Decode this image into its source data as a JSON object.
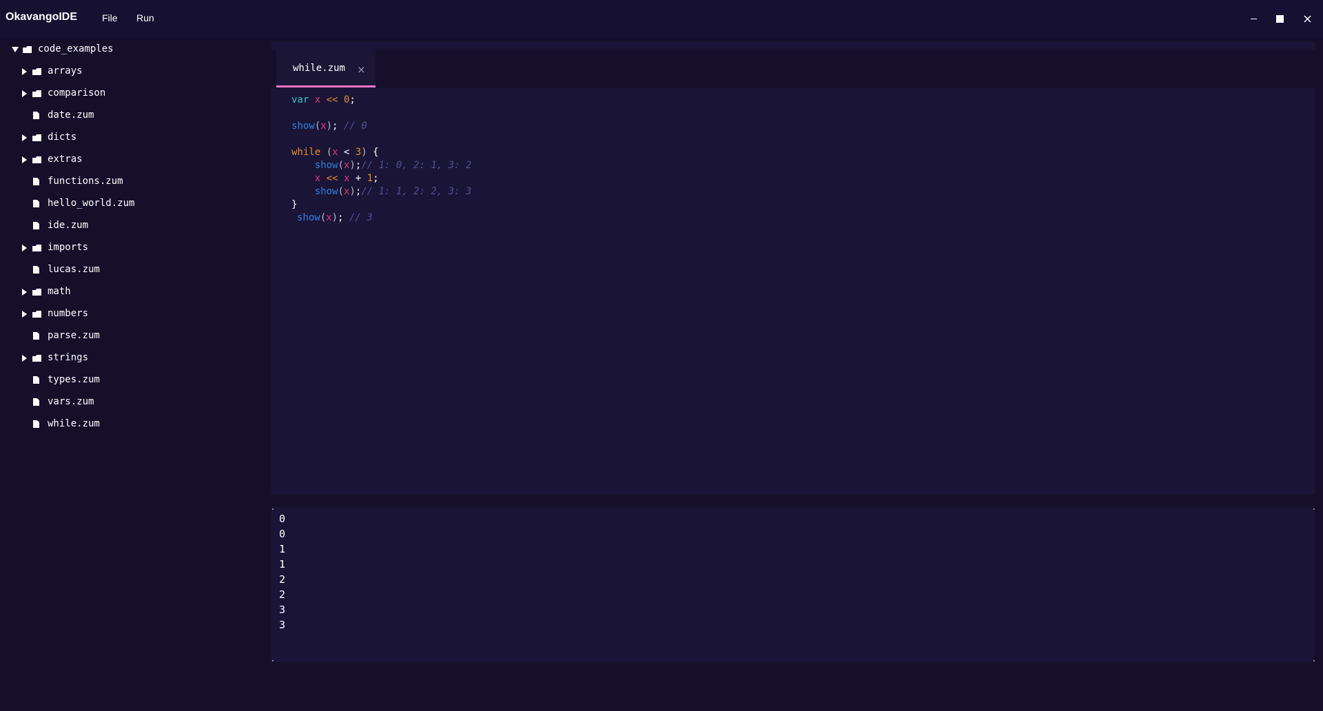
{
  "app": {
    "title": "OkavangoIDE"
  },
  "menu": {
    "file": "File",
    "run": "Run"
  },
  "window_controls": {
    "minimize": "minimize-icon",
    "maximize": "maximize-icon",
    "close": "close-icon"
  },
  "explorer": {
    "root": "code_examples",
    "items": [
      {
        "type": "folder",
        "label": "arrays"
      },
      {
        "type": "folder",
        "label": "comparison"
      },
      {
        "type": "file",
        "label": "date.zum"
      },
      {
        "type": "folder",
        "label": "dicts"
      },
      {
        "type": "folder",
        "label": "extras"
      },
      {
        "type": "file",
        "label": "functions.zum"
      },
      {
        "type": "file",
        "label": "hello_world.zum"
      },
      {
        "type": "file",
        "label": "ide.zum"
      },
      {
        "type": "folder",
        "label": "imports"
      },
      {
        "type": "file",
        "label": "lucas.zum"
      },
      {
        "type": "folder",
        "label": "math"
      },
      {
        "type": "folder",
        "label": "numbers"
      },
      {
        "type": "file",
        "label": "parse.zum"
      },
      {
        "type": "folder",
        "label": "strings"
      },
      {
        "type": "file",
        "label": "types.zum"
      },
      {
        "type": "file",
        "label": "vars.zum"
      },
      {
        "type": "file",
        "label": "while.zum"
      }
    ]
  },
  "editor": {
    "tab": {
      "label": "while.zum",
      "close": "×"
    },
    "code": {
      "l1": {
        "kw": "var",
        "x": "x",
        "op": "<<",
        "num": "0",
        "semi": ";"
      },
      "l2": {
        "fn": "show",
        "lp": "(",
        "x": "x",
        "rp": ")",
        "semi": ";",
        "cmt": "// 0"
      },
      "l3": {
        "kw": "while",
        "lp": "(",
        "x": "x",
        "op": "<",
        "num": "3",
        "rp": ")",
        "brace": "{"
      },
      "l4": {
        "fn": "show",
        "lp": "(",
        "x": "x",
        "rp": ")",
        "semi": ";",
        "cmt": "// 1: 0, 2: 1, 3: 2"
      },
      "l5": {
        "x1": "x",
        "op1": "<<",
        "x2": "x",
        "op2": "+",
        "num": "1",
        "semi": ";"
      },
      "l6": {
        "fn": "show",
        "lp": "(",
        "x": "x",
        "rp": ")",
        "semi": ";",
        "cmt": "// 1: 1, 2: 2, 3: 3"
      },
      "l7": {
        "brace": "}"
      },
      "l8": {
        "fn": "show",
        "lp": "(",
        "x": "x",
        "rp": ")",
        "semi": ";",
        "cmt": "// 3"
      }
    }
  },
  "output": {
    "lines": [
      "0",
      "0",
      "1",
      "1",
      "2",
      "2",
      "3",
      "3"
    ]
  },
  "colors": {
    "background": "#150f2a",
    "panel": "#1a1536",
    "tab_accent": "#f277c8",
    "keyword_var": "#37c4cf",
    "keyword_while": "#e88b2a",
    "identifier": "#e2367b",
    "function": "#2f7fe0",
    "comment": "#4f5193"
  }
}
